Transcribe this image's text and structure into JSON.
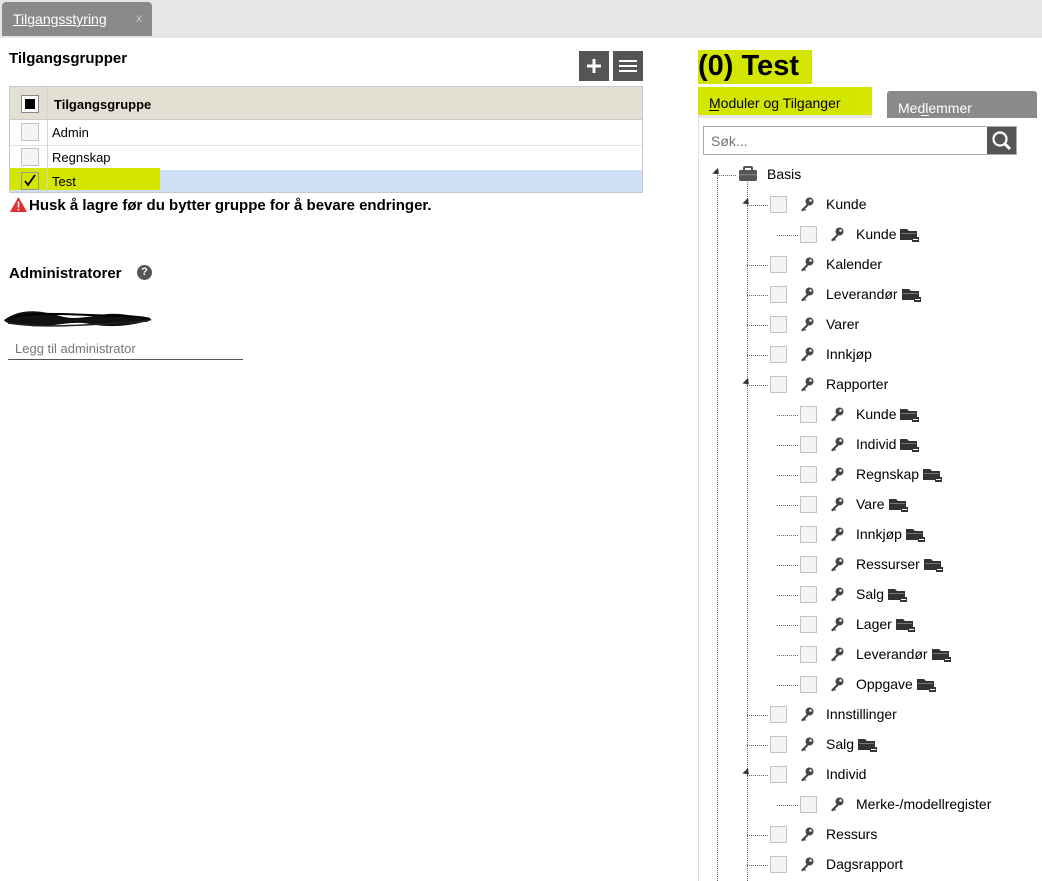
{
  "window_tab": {
    "label": "Tilgangsstyring",
    "close": "x"
  },
  "groups": {
    "heading": "Tilgangsgrupper",
    "column_header": "Tilgangsgruppe",
    "rows": [
      {
        "label": "Admin",
        "checked": false
      },
      {
        "label": "Regnskap",
        "checked": false
      },
      {
        "label": "Test",
        "checked": true
      }
    ],
    "warning": "Husk å lagre før du bytter gruppe for å bevare endringer."
  },
  "admins": {
    "heading": "Administratorer",
    "help": "?",
    "input_placeholder": "Legg til administrator"
  },
  "detail": {
    "title": "(0) Test",
    "tabs": [
      {
        "label": "Moduler og Tilganger",
        "accesskey": "M"
      },
      {
        "label": "Medlemmer",
        "accesskey": "d"
      }
    ],
    "search_placeholder": "Søk..."
  },
  "tree": [
    {
      "label": "Basis",
      "level": 0,
      "type": "module",
      "expanded": true
    },
    {
      "label": "Kunde",
      "level": 1,
      "expanded": true
    },
    {
      "label": "Kunde",
      "level": 2,
      "folder": true
    },
    {
      "label": "Kalender",
      "level": 1
    },
    {
      "label": "Leverandør",
      "level": 1,
      "folder": true
    },
    {
      "label": "Varer",
      "level": 1
    },
    {
      "label": "Innkjøp",
      "level": 1
    },
    {
      "label": "Rapporter",
      "level": 1,
      "expanded": true
    },
    {
      "label": "Kunde",
      "level": 2,
      "folder": true
    },
    {
      "label": "Individ",
      "level": 2,
      "folder": true
    },
    {
      "label": "Regnskap",
      "level": 2,
      "folder": true
    },
    {
      "label": "Vare",
      "level": 2,
      "folder": true
    },
    {
      "label": "Innkjøp",
      "level": 2,
      "folder": true
    },
    {
      "label": "Ressurser",
      "level": 2,
      "folder": true
    },
    {
      "label": "Salg",
      "level": 2,
      "folder": true
    },
    {
      "label": "Lager",
      "level": 2,
      "folder": true
    },
    {
      "label": "Leverandør",
      "level": 2,
      "folder": true
    },
    {
      "label": "Oppgave",
      "level": 2,
      "folder": true
    },
    {
      "label": "Innstillinger",
      "level": 1
    },
    {
      "label": "Salg",
      "level": 1,
      "folder": true
    },
    {
      "label": "Individ",
      "level": 1,
      "expanded": true
    },
    {
      "label": "Merke-/modellregister",
      "level": 2
    },
    {
      "label": "Ressurs",
      "level": 1
    },
    {
      "label": "Dagsrapport",
      "level": 1
    }
  ]
}
